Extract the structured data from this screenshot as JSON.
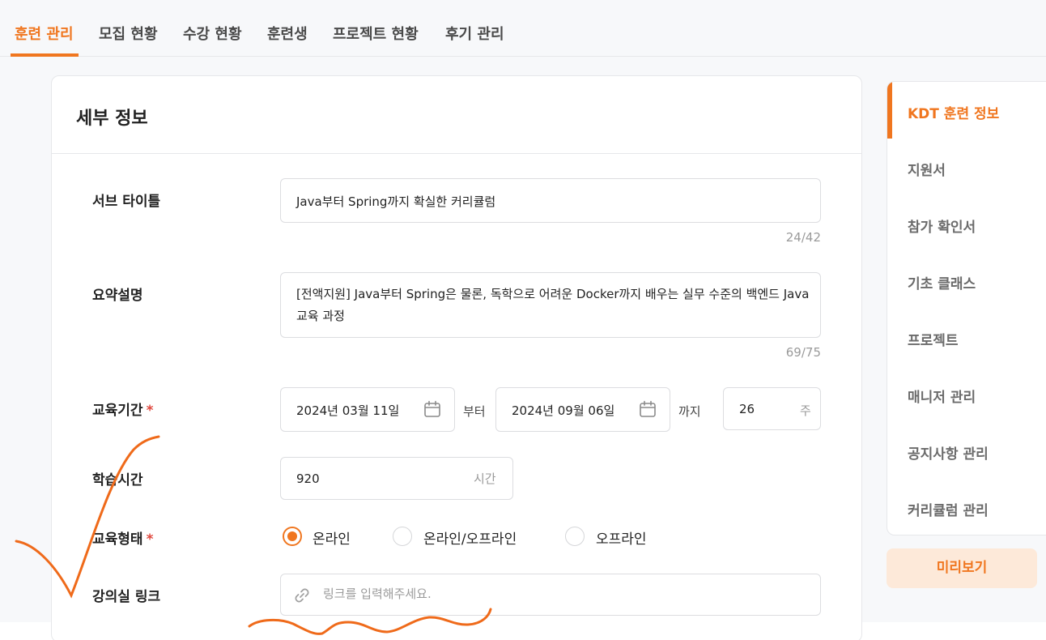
{
  "nav": {
    "tabs": [
      {
        "label": "훈련 관리"
      },
      {
        "label": "모집 현황"
      },
      {
        "label": "수강 현황"
      },
      {
        "label": "훈련생"
      },
      {
        "label": "프로젝트 현황"
      },
      {
        "label": "후기 관리"
      }
    ]
  },
  "card": {
    "title": "세부 정보",
    "subtitle": {
      "label": "서브 타이틀",
      "value": "Java부터 Spring까지 확실한 커리큘럼",
      "counter": "24/42"
    },
    "summary": {
      "label": "요약설명",
      "value": "[전액지원] Java부터 Spring은 물론, 독학으로 어려운 Docker까지 배우는 실무 수준의 백엔드 Java 교육 과정",
      "counter": "69/75"
    },
    "period": {
      "label": "교육기간",
      "required_mark": "*",
      "start": "2024년 03월 11일",
      "from_text": "부터",
      "end": "2024년 09월 06일",
      "to_text": "까지",
      "weeks": "26",
      "weeks_unit": "주"
    },
    "hours": {
      "label": "학습시간",
      "value": "920",
      "unit": "시간"
    },
    "format": {
      "label": "교육형태",
      "required_mark": "*",
      "options": [
        {
          "label": "온라인",
          "selected": true
        },
        {
          "label": "온라인/오프라인",
          "selected": false
        },
        {
          "label": "오프라인",
          "selected": false
        }
      ]
    },
    "link": {
      "label": "강의실 링크",
      "placeholder": "링크를 입력해주세요."
    }
  },
  "sidebar": {
    "items": [
      {
        "label": "KDT 훈련 정보",
        "active": true
      },
      {
        "label": "지원서"
      },
      {
        "label": "참가 확인서"
      },
      {
        "label": "기초 클래스"
      },
      {
        "label": "프로젝트"
      },
      {
        "label": "매니저 관리"
      },
      {
        "label": "공지사항 관리"
      },
      {
        "label": "커리큘럼 관리"
      }
    ],
    "preview_label": "미리보기"
  },
  "colors": {
    "accent": "#f0761f",
    "required": "#e0483e",
    "preview_bg": "#fde9d9"
  },
  "icons": [
    "calendar-icon",
    "link-icon"
  ]
}
